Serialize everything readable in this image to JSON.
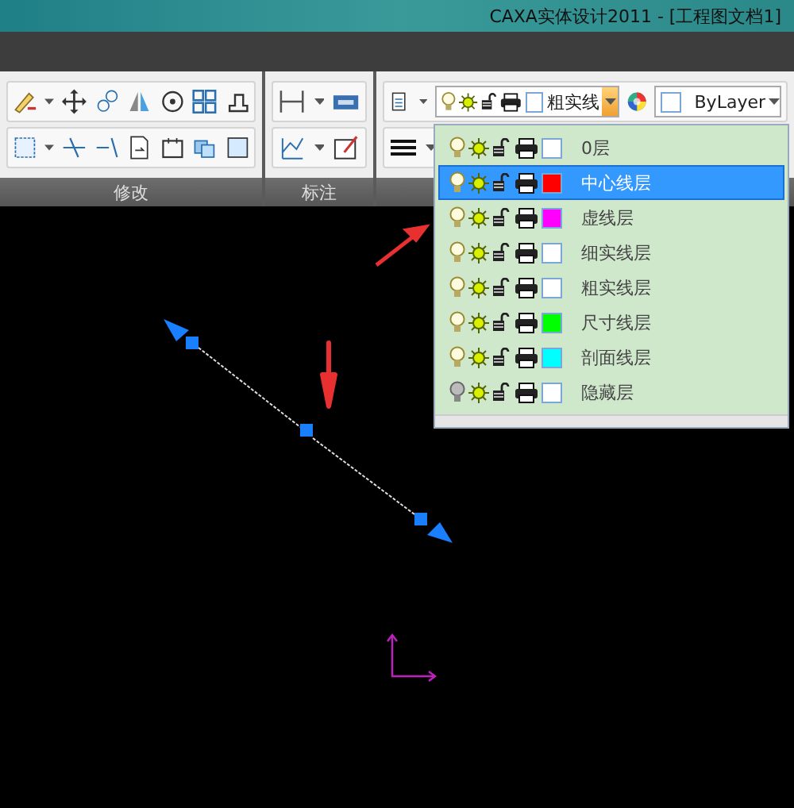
{
  "window": {
    "title": "CAXA实体设计2011 - [工程图文档1]"
  },
  "ribbon": {
    "groups": [
      {
        "label": "修改"
      },
      {
        "label": "标注"
      }
    ]
  },
  "layer_combo": {
    "value": "粗实线"
  },
  "color_combo": {
    "value": "ByLayer"
  },
  "layer_list": {
    "items": [
      {
        "name": "0层",
        "color": "#ffffff",
        "on": true,
        "selected": false
      },
      {
        "name": "中心线层",
        "color": "#ff0000",
        "on": true,
        "selected": true
      },
      {
        "name": "虚线层",
        "color": "#ff00ff",
        "on": true,
        "selected": false
      },
      {
        "name": "细实线层",
        "color": "#ffffff",
        "on": true,
        "selected": false
      },
      {
        "name": "粗实线层",
        "color": "#ffffff",
        "on": true,
        "selected": false
      },
      {
        "name": "尺寸线层",
        "color": "#00ff00",
        "on": true,
        "selected": false
      },
      {
        "name": "剖面线层",
        "color": "#00ffff",
        "on": true,
        "selected": false
      },
      {
        "name": "隐藏层",
        "color": "#ffffff",
        "on": false,
        "selected": false
      }
    ]
  }
}
